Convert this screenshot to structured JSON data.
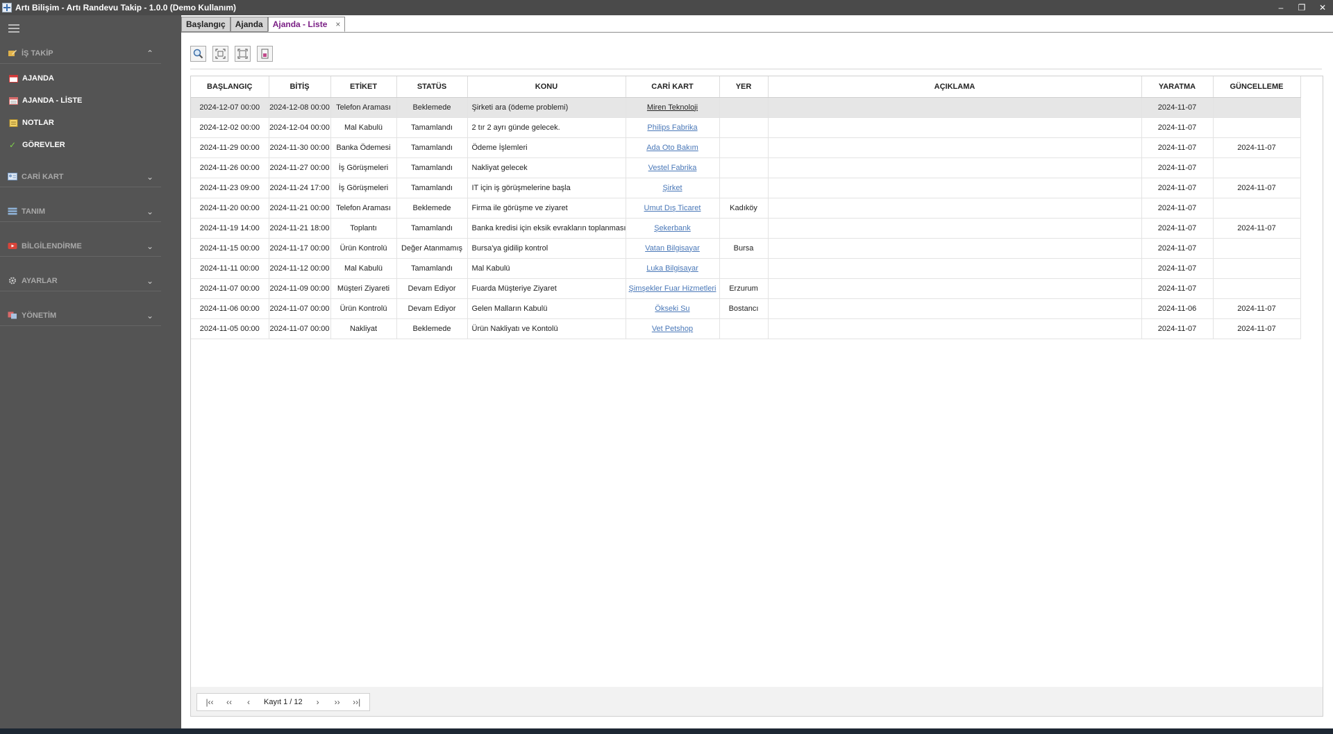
{
  "window": {
    "title": "Artı Bilişim - Artı Randevu Takip - 1.0.0 (Demo Kullanım)",
    "minimize": "–",
    "restore": "❐",
    "close": "✕"
  },
  "sidebar": {
    "groups": [
      {
        "label": "İŞ TAKİP",
        "icon": "pencil-note-icon",
        "chevron": "⌃",
        "color": "#e0b24a"
      },
      {
        "label": "CARİ KART",
        "icon": "id-card-icon",
        "chevron": "⌄",
        "color": "#8fb3d9"
      },
      {
        "label": "TANIM",
        "icon": "list-icon",
        "chevron": "⌄",
        "color": "#8fb3d9"
      },
      {
        "label": "BİLGİLENDİRME",
        "icon": "video-icon",
        "chevron": "⌄",
        "color": "#d9443a"
      },
      {
        "label": "AYARLAR",
        "icon": "gear-icon",
        "chevron": "⌄",
        "color": "#bbbbbb"
      },
      {
        "label": "YÖNETİM",
        "icon": "users-icon",
        "chevron": "⌄",
        "color": "#d96a6a"
      }
    ],
    "items": [
      {
        "label": "AJANDA",
        "icon": "calendar-icon"
      },
      {
        "label": "AJANDA - LİSTE",
        "icon": "calendar-list-icon"
      },
      {
        "label": "NOTLAR",
        "icon": "note-icon"
      },
      {
        "label": "GÖREVLER",
        "icon": "check-icon",
        "glyph": "✓"
      }
    ]
  },
  "tabs": [
    {
      "label": "Başlangıç"
    },
    {
      "label": "Ajanda"
    },
    {
      "label": "Ajanda - Liste",
      "close": "×"
    }
  ],
  "toolbar": [
    {
      "name": "search-icon"
    },
    {
      "name": "expand-icon"
    },
    {
      "name": "collapse-icon"
    },
    {
      "name": "export-icon"
    }
  ],
  "table": {
    "columns": [
      "BAŞLANGIÇ",
      "BİTİŞ",
      "ETİKET",
      "STATÜS",
      "KONU",
      "CARİ KART",
      "YER",
      "AÇIKLAMA",
      "YARATMA",
      "GÜNCELLEME"
    ],
    "rows": [
      [
        "2024-12-07 00:00",
        "2024-12-08 00:00",
        "Telefon Araması",
        "Beklemede",
        "Şirketi ara (ödeme problemi)",
        "Miren Teknoloji",
        "",
        "",
        "2024-11-07",
        ""
      ],
      [
        "2024-12-02 00:00",
        "2024-12-04 00:00",
        "Mal Kabulü",
        "Tamamlandı",
        "2 tır 2 ayrı günde gelecek.",
        "Philips Fabrika",
        "",
        "",
        "2024-11-07",
        ""
      ],
      [
        "2024-11-29 00:00",
        "2024-11-30 00:00",
        "Banka Ödemesi",
        "Tamamlandı",
        "Ödeme İşlemleri",
        "Ada Oto Bakım",
        "",
        "",
        "2024-11-07",
        "2024-11-07"
      ],
      [
        "2024-11-26 00:00",
        "2024-11-27 00:00",
        "İş Görüşmeleri",
        "Tamamlandı",
        "Nakliyat gelecek",
        "Vestel Fabrika",
        "",
        "",
        "2024-11-07",
        ""
      ],
      [
        "2024-11-23 09:00",
        "2024-11-24 17:00",
        "İş Görüşmeleri",
        "Tamamlandı",
        "IT için iş görüşmelerine başla",
        "Şirket",
        "",
        "",
        "2024-11-07",
        "2024-11-07"
      ],
      [
        "2024-11-20 00:00",
        "2024-11-21 00:00",
        "Telefon Araması",
        "Beklemede",
        "Firma ile görüşme ve ziyaret",
        "Umut Dış Ticaret",
        "Kadıköy",
        "",
        "2024-11-07",
        ""
      ],
      [
        "2024-11-19 14:00",
        "2024-11-21 18:00",
        "Toplantı",
        "Tamamlandı",
        "Banka kredisi için eksik evrakların toplanması",
        "Şekerbank",
        "",
        "",
        "2024-11-07",
        "2024-11-07"
      ],
      [
        "2024-11-15 00:00",
        "2024-11-17 00:00",
        "Ürün Kontrolü",
        "Değer Atanmamış",
        "Bursa'ya gidilip kontrol",
        "Vatan Bilgisayar",
        "Bursa",
        "",
        "2024-11-07",
        ""
      ],
      [
        "2024-11-11 00:00",
        "2024-11-12 00:00",
        "Mal Kabulü",
        "Tamamlandı",
        "Mal Kabulü",
        "Luka Bilgisayar",
        "",
        "",
        "2024-11-07",
        ""
      ],
      [
        "2024-11-07 00:00",
        "2024-11-09 00:00",
        "Müşteri Ziyareti",
        "Devam Ediyor",
        "Fuarda Müşteriye Ziyaret",
        "Şimşekler Fuar Hizmetleri",
        "Erzurum",
        "",
        "2024-11-07",
        ""
      ],
      [
        "2024-11-06 00:00",
        "2024-11-07 00:00",
        "Ürün Kontrolü",
        "Devam Ediyor",
        "Gelen Malların Kabulü",
        "Ökseki Su",
        "Bostancı",
        "",
        "2024-11-06",
        "2024-11-07"
      ],
      [
        "2024-11-05 00:00",
        "2024-11-07 00:00",
        "Nakliyat",
        "Beklemede",
        "Ürün Nakliyatı ve Kontolü",
        "Vet Petshop",
        "",
        "",
        "2024-11-07",
        "2024-11-07"
      ]
    ]
  },
  "pager": {
    "first": "|‹‹",
    "prev_page": "‹‹",
    "prev": "‹",
    "text": "Kayıt 1 / 12",
    "next": "›",
    "next_page": "››",
    "last": "››|"
  }
}
